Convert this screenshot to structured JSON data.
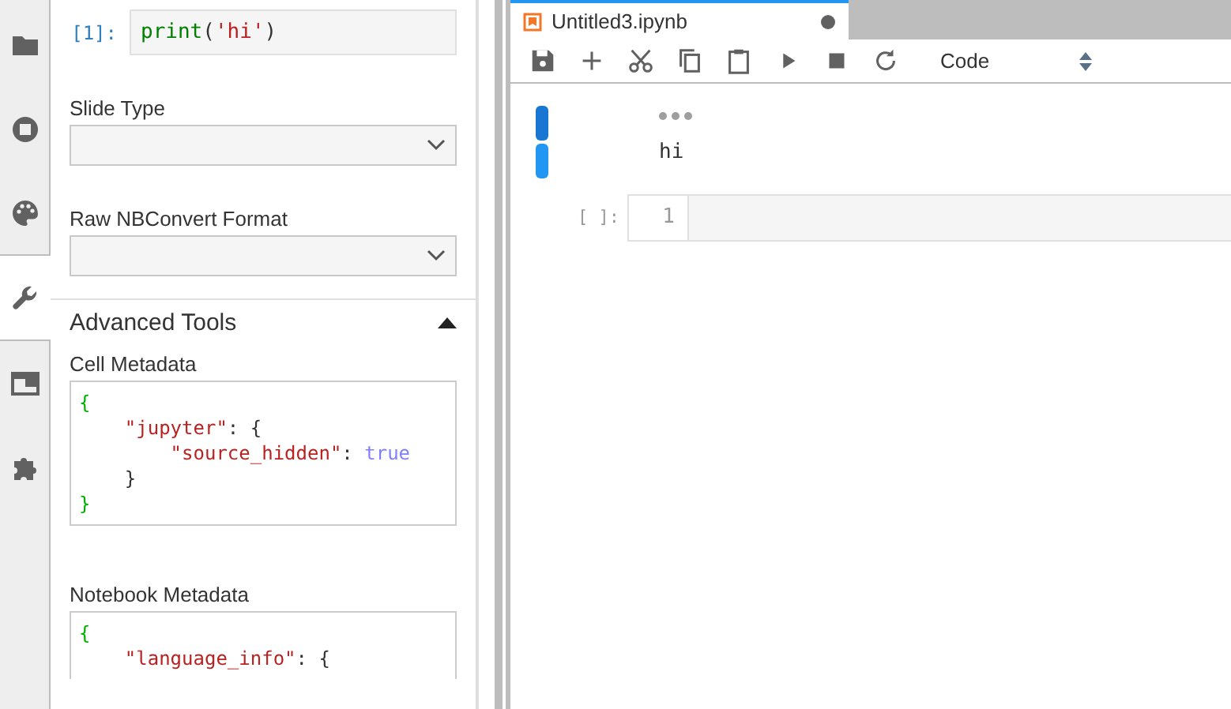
{
  "activity_bar": {
    "items": [
      {
        "selected": false
      },
      {
        "selected": false
      },
      {
        "selected": false
      },
      {
        "selected": true
      },
      {
        "selected": false
      },
      {
        "selected": false
      }
    ]
  },
  "property_inspector": {
    "active_cell": {
      "prompt": "[1]:",
      "code": [
        {
          "text": "print",
          "kind": "builtin"
        },
        {
          "text": "(",
          "kind": "punct"
        },
        {
          "text": "'hi'",
          "kind": "string"
        },
        {
          "text": ")",
          "kind": "punct"
        }
      ]
    },
    "fields": [
      {
        "label": "Slide Type"
      },
      {
        "label": "Raw NBConvert Format"
      }
    ],
    "advanced_tools": {
      "title": "Advanced Tools",
      "expanded": true,
      "editors": [
        {
          "label": "Cell Metadata",
          "lines": [
            [
              {
                "text": "{",
                "kind": "brace"
              }
            ],
            [
              {
                "text": "    \"jupyter\"",
                "kind": "string"
              },
              {
                "text": ": {",
                "kind": "punct"
              }
            ],
            [
              {
                "text": "        \"source_hidden\"",
                "kind": "string"
              },
              {
                "text": ": ",
                "kind": "punct"
              },
              {
                "text": "true",
                "kind": "bool"
              }
            ],
            [
              {
                "text": "    }",
                "kind": "punct"
              }
            ],
            [
              {
                "text": "}",
                "kind": "brace"
              }
            ]
          ]
        },
        {
          "label": "Notebook Metadata",
          "lines": [
            [
              {
                "text": "{",
                "kind": "brace"
              }
            ],
            [
              {
                "text": "    \"language_info\"",
                "kind": "string"
              },
              {
                "text": ": {",
                "kind": "punct"
              }
            ]
          ]
        }
      ]
    }
  },
  "notebook": {
    "tab": {
      "title": "Untitled3.ipynb",
      "modified": true
    },
    "toolbar": {
      "cell_type": "Code"
    },
    "cells": [
      {
        "kind": "output",
        "collapser_selected": true,
        "output": "hi"
      },
      {
        "kind": "code",
        "prompt": "[ ]:",
        "line_number": "1"
      }
    ]
  }
}
